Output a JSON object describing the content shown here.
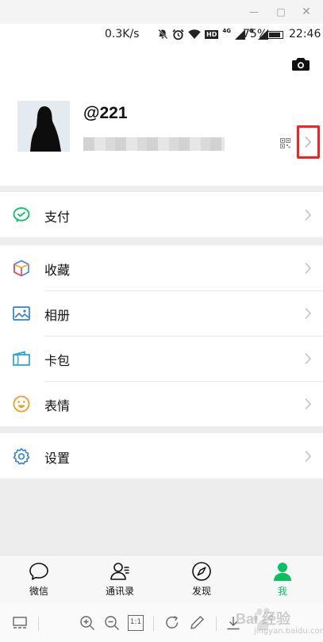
{
  "window": {
    "min_glyph": "—",
    "max_glyph": "□",
    "close_glyph": "✕"
  },
  "status_bar": {
    "speed": "0.3K/s",
    "battery_percent": "75%",
    "battery_level": 0.75,
    "time": "22:46",
    "net_labels": [
      "HD",
      "4G",
      "G"
    ]
  },
  "profile": {
    "nickname": "@221"
  },
  "groups": [
    {
      "items": [
        {
          "label": "支付",
          "icon": "wechat-pay-icon"
        }
      ]
    },
    {
      "items": [
        {
          "label": "收藏",
          "icon": "favorites-cube-icon"
        },
        {
          "label": "相册",
          "icon": "album-icon"
        },
        {
          "label": "卡包",
          "icon": "card-wallet-icon"
        },
        {
          "label": "表情",
          "icon": "sticker-smile-icon"
        }
      ]
    },
    {
      "items": [
        {
          "label": "设置",
          "icon": "settings-gear-icon"
        }
      ]
    }
  ],
  "tabbar": {
    "tabs": [
      {
        "label": "微信",
        "icon": "chat-bubble-icon",
        "active": false
      },
      {
        "label": "通讯录",
        "icon": "contacts-icon",
        "active": false
      },
      {
        "label": "发现",
        "icon": "compass-icon",
        "active": false
      },
      {
        "label": "我",
        "icon": "me-person-icon",
        "active": true
      }
    ]
  },
  "colors": {
    "accent": "#07c160",
    "highlight_box": "#ff1e1e",
    "background": "#ededed"
  },
  "toolbar": {
    "actual_size_label": "1:1",
    "watermark_text": "Bai 经验",
    "watermark_url": "jingyan.baidu.com"
  }
}
